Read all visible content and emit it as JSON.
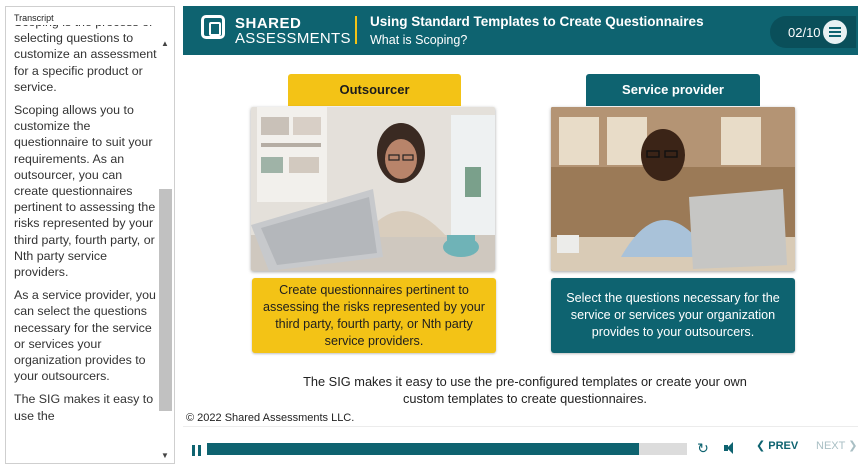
{
  "transcript": {
    "label": "Transcript",
    "paragraphs": [
      "Scoping is the process of selecting questions to customize an assessment for a specific product or service.",
      "Scoping allows you to customize the questionnaire to suit your requirements. As an outsourcer, you can create questionnaires pertinent to assessing the risks represented by your third party, fourth party, or Nth party service providers.",
      "As a service provider, you can select the questions necessary for the service or services your organization provides to your outsourcers.",
      "The SIG makes it easy to use the"
    ],
    "scroll_up_icon": "triangle-up-icon",
    "scroll_down_icon": "triangle-down-icon"
  },
  "header": {
    "brand_top": "SHARED",
    "brand_bottom": "ASSESSMENTS",
    "course_title": "Using Standard Templates to Create Questionnaires",
    "slide_title": "What is Scoping?",
    "page_counter": "02/10",
    "menu_icon": "hamburger-menu-icon",
    "colors": {
      "teal": "#0e6370",
      "yellow": "#f3c316"
    }
  },
  "cards": {
    "outsourcer": {
      "tab_label": "Outsourcer",
      "description": "Create questionnaires pertinent to assessing the risks represented by your third party, fourth party, or Nth party service providers."
    },
    "service_provider": {
      "tab_label": "Service provider",
      "description": "Select the questions necessary for the service or services your organization provides to your outsourcers."
    }
  },
  "summary": "The SIG makes it easy to use the pre-configured templates or create your own custom templates to create questionnaires.",
  "copyright": "© 2022 Shared Assessments LLC.",
  "player": {
    "progress_fraction": 0.9,
    "prev_label": "PREV",
    "next_label": "NEXT",
    "icons": [
      "pause-icon",
      "replay-icon",
      "volume-icon",
      "chevron-left-icon",
      "chevron-right-icon"
    ]
  }
}
